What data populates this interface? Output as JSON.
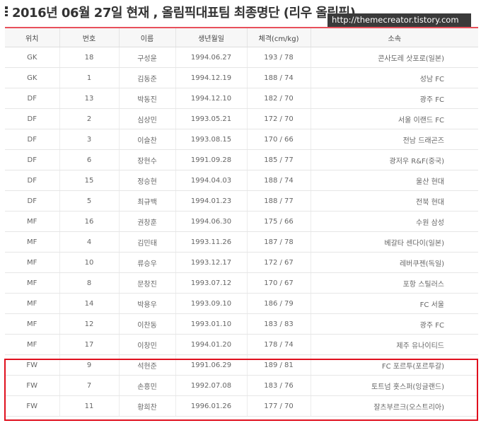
{
  "title": "2016년 06월 27일 현재 , 올림픽대표팀 최종명단 (리우 올림픽)",
  "watermark": "http://themecreator.tistory.com",
  "colors": {
    "accent_border": "#e8505b",
    "highlight_box": "#e0101e",
    "header_bg": "#f7f7f7"
  },
  "table": {
    "headers": [
      "위치",
      "번호",
      "이름",
      "생년월일",
      "체격(cm/kg)",
      "소속"
    ],
    "rows": [
      [
        "GK",
        "18",
        "구성윤",
        "1994.06.27",
        "193 / 78",
        "콘사도레 삿포로(일본)"
      ],
      [
        "GK",
        "1",
        "김동준",
        "1994.12.19",
        "188 / 74",
        "성남 FC"
      ],
      [
        "DF",
        "13",
        "박동진",
        "1994.12.10",
        "182 / 70",
        "광주 FC"
      ],
      [
        "DF",
        "2",
        "심상민",
        "1993.05.21",
        "172 / 70",
        "서울 이랜드 FC"
      ],
      [
        "DF",
        "3",
        "이슬찬",
        "1993.08.15",
        "170 / 66",
        "전남 드래곤즈"
      ],
      [
        "DF",
        "6",
        "장현수",
        "1991.09.28",
        "185 / 77",
        "광저우 R&F(중국)"
      ],
      [
        "DF",
        "15",
        "정승현",
        "1994.04.03",
        "188 / 74",
        "울산 현대"
      ],
      [
        "DF",
        "5",
        "최규백",
        "1994.01.23",
        "188 / 77",
        "전북 현대"
      ],
      [
        "MF",
        "16",
        "권창훈",
        "1994.06.30",
        "175 / 66",
        "수원 삼성"
      ],
      [
        "MF",
        "4",
        "김민태",
        "1993.11.26",
        "187 / 78",
        "베갈타 센다이(일본)"
      ],
      [
        "MF",
        "10",
        "류승우",
        "1993.12.17",
        "172 / 67",
        "레버쿠젠(독일)"
      ],
      [
        "MF",
        "8",
        "문창진",
        "1993.07.12",
        "170 / 67",
        "포항 스틸러스"
      ],
      [
        "MF",
        "14",
        "박용우",
        "1993.09.10",
        "186 / 79",
        "FC 서울"
      ],
      [
        "MF",
        "12",
        "이찬동",
        "1993.01.10",
        "183 / 83",
        "광주 FC"
      ],
      [
        "MF",
        "17",
        "이창민",
        "1994.01.20",
        "178 / 74",
        "제주 유나이티드"
      ],
      [
        "FW",
        "9",
        "석현준",
        "1991.06.29",
        "189 / 81",
        "FC 포르투(포르투갈)"
      ],
      [
        "FW",
        "7",
        "손흥민",
        "1992.07.08",
        "183 / 76",
        "토트넘 홋스퍼(잉글랜드)"
      ],
      [
        "FW",
        "11",
        "황희찬",
        "1996.01.26",
        "177 / 70",
        "잘츠부르크(오스트리아)"
      ]
    ]
  }
}
